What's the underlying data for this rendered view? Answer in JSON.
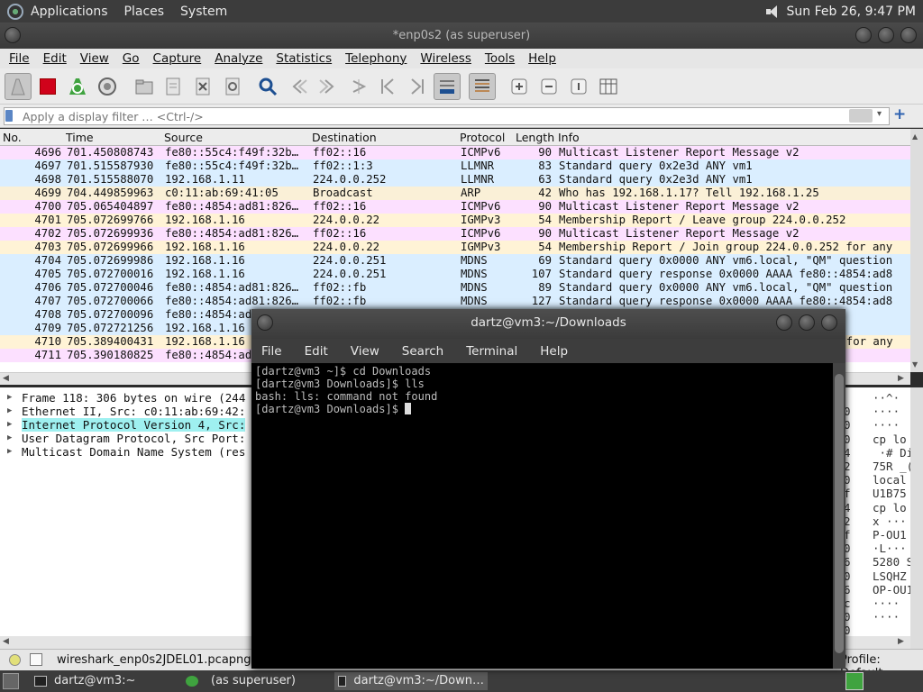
{
  "top_panel": {
    "menu": [
      "Applications",
      "Places",
      "System"
    ],
    "clock": "Sun Feb 26,  9:47 PM"
  },
  "wireshark": {
    "title": "*enp0s2 (as superuser)",
    "menubar": [
      "File",
      "Edit",
      "View",
      "Go",
      "Capture",
      "Analyze",
      "Statistics",
      "Telephony",
      "Wireless",
      "Tools",
      "Help"
    ],
    "filter_placeholder": "Apply a display filter … <Ctrl-/>",
    "columns": [
      "No.",
      "Time",
      "Source",
      "Destination",
      "Protocol",
      "Length",
      "Info"
    ],
    "packets": [
      {
        "no": "4696",
        "time": "701.450808743",
        "src": "fe80::55c4:f49f:32b…",
        "dst": "ff02::16",
        "proto": "ICMPv6",
        "len": "90",
        "info": "Multicast Listener Report Message v2",
        "color": "#fce0ff"
      },
      {
        "no": "4697",
        "time": "701.515587930",
        "src": "fe80::55c4:f49f:32b…",
        "dst": "ff02::1:3",
        "proto": "LLMNR",
        "len": "83",
        "info": "Standard query 0x2e3d ANY vm1",
        "color": "#daeeff"
      },
      {
        "no": "4698",
        "time": "701.515588070",
        "src": "192.168.1.11",
        "dst": "224.0.0.252",
        "proto": "LLMNR",
        "len": "63",
        "info": "Standard query 0x2e3d ANY vm1",
        "color": "#daeeff"
      },
      {
        "no": "4699",
        "time": "704.449859963",
        "src": "c0:11:ab:69:41:05",
        "dst": "Broadcast",
        "proto": "ARP",
        "len": "42",
        "info": "Who has 192.168.1.17? Tell 192.168.1.25",
        "color": "#faf0d7"
      },
      {
        "no": "4700",
        "time": "705.065404897",
        "src": "fe80::4854:ad81:826…",
        "dst": "ff02::16",
        "proto": "ICMPv6",
        "len": "90",
        "info": "Multicast Listener Report Message v2",
        "color": "#fce0ff"
      },
      {
        "no": "4701",
        "time": "705.072699766",
        "src": "192.168.1.16",
        "dst": "224.0.0.22",
        "proto": "IGMPv3",
        "len": "54",
        "info": "Membership Report / Leave group 224.0.0.252",
        "color": "#fff3d6"
      },
      {
        "no": "4702",
        "time": "705.072699936",
        "src": "fe80::4854:ad81:826…",
        "dst": "ff02::16",
        "proto": "ICMPv6",
        "len": "90",
        "info": "Multicast Listener Report Message v2",
        "color": "#fce0ff"
      },
      {
        "no": "4703",
        "time": "705.072699966",
        "src": "192.168.1.16",
        "dst": "224.0.0.22",
        "proto": "IGMPv3",
        "len": "54",
        "info": "Membership Report / Join group 224.0.0.252 for any",
        "color": "#fff3d6"
      },
      {
        "no": "4704",
        "time": "705.072699986",
        "src": "192.168.1.16",
        "dst": "224.0.0.251",
        "proto": "MDNS",
        "len": "69",
        "info": "Standard query 0x0000 ANY vm6.local, \"QM\" question",
        "color": "#daeeff"
      },
      {
        "no": "4705",
        "time": "705.072700016",
        "src": "192.168.1.16",
        "dst": "224.0.0.251",
        "proto": "MDNS",
        "len": "107",
        "info": "Standard query response 0x0000 AAAA fe80::4854:ad8",
        "color": "#daeeff"
      },
      {
        "no": "4706",
        "time": "705.072700046",
        "src": "fe80::4854:ad81:826…",
        "dst": "ff02::fb",
        "proto": "MDNS",
        "len": "89",
        "info": "Standard query 0x0000 ANY vm6.local, \"QM\" question",
        "color": "#daeeff"
      },
      {
        "no": "4707",
        "time": "705.072700066",
        "src": "fe80::4854:ad81:826…",
        "dst": "ff02::fb",
        "proto": "MDNS",
        "len": "127",
        "info": "Standard query response 0x0000 AAAA fe80::4854:ad8",
        "color": "#daeeff"
      },
      {
        "no": "4708",
        "time": "705.072700096",
        "src": "fe80::4854:ad",
        "dst": "",
        "proto": "",
        "len": "",
        "info": "",
        "color": "#daeeff"
      },
      {
        "no": "4709",
        "time": "705.072721256",
        "src": "192.168.1.16",
        "dst": "",
        "proto": "",
        "len": "",
        "info": "",
        "color": "#daeeff"
      },
      {
        "no": "4710",
        "time": "705.389400431",
        "src": "192.168.1.16",
        "dst": "",
        "proto": "",
        "len": "",
        "info": "2 for any",
        "color": "#fff3d6"
      },
      {
        "no": "4711",
        "time": "705.390180825",
        "src": "fe80::4854:ad",
        "dst": "",
        "proto": "",
        "len": "",
        "info": "",
        "color": "#fce0ff"
      }
    ],
    "details": [
      {
        "text": "Frame 118: 306 bytes on wire (244",
        "highlight": false
      },
      {
        "text": "Ethernet II, Src: c0:11:ab:69:42:",
        "highlight": false
      },
      {
        "text": "Internet Protocol Version 4, Src:",
        "highlight": true
      },
      {
        "text": "User Datagram Protocol, Src Port:",
        "highlight": false
      },
      {
        "text": "Multicast Domain Name System (res",
        "highlight": false
      }
    ],
    "hex_digits": "\n0\n0\n0\n4\n2\n0\nf\n4\n2\nf\n0\n6\n0\n6\nc\n0\n0",
    "ascii_dump": "··^·\n····\n····\ncp lo\n ·# Di\n75R _(\nlocal\nU1B75\ncp lo\nx ···\nP-OU1\n·L···\n5280 S\nLSQHZ\nOP-OU1\n····\n····",
    "status_file": "wireshark_enp0s2JDEL01.pcapng",
    "status_profile": "Profile: Default"
  },
  "terminal": {
    "title": "dartz@vm3:~/Downloads",
    "menubar": [
      "File",
      "Edit",
      "View",
      "Search",
      "Terminal",
      "Help"
    ],
    "lines": [
      "[dartz@vm3 ~]$ cd Downloads",
      "[dartz@vm3 Downloads]$ lls",
      "bash: lls: command not found"
    ],
    "prompt": "[dartz@vm3 Downloads]$ "
  },
  "taskbar": {
    "items": [
      "dartz@vm3:~",
      "(as superuser)",
      "dartz@vm3:~/Down…"
    ]
  }
}
